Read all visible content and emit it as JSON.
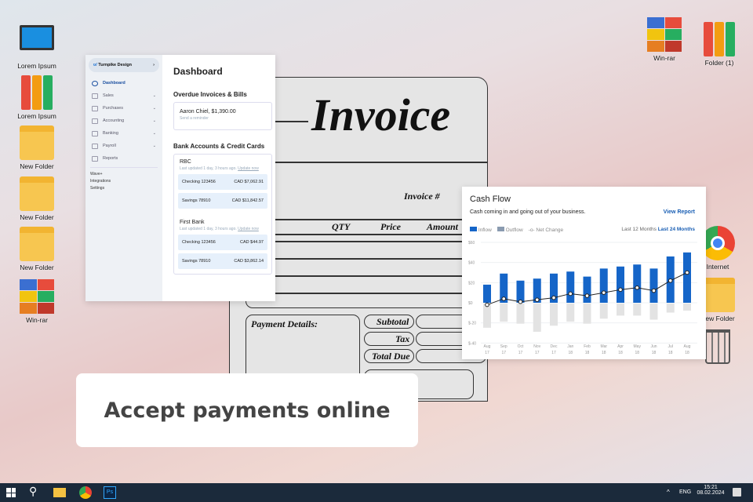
{
  "desktop": {
    "left": [
      "Lorem Ipsum",
      "Lorem Ipsum",
      "New Folder",
      "New Folder",
      "New Folder",
      "Win-rar"
    ],
    "right": [
      "Win-rar",
      "Folder (1)",
      "Internet",
      "New Folder"
    ]
  },
  "dashboard": {
    "brand": "Turnpike Design",
    "nav": [
      {
        "label": "Dashboard",
        "active": true
      },
      {
        "label": "Sales"
      },
      {
        "label": "Purchases"
      },
      {
        "label": "Accounting"
      },
      {
        "label": "Banking"
      },
      {
        "label": "Payroll"
      },
      {
        "label": "Reports"
      }
    ],
    "links": [
      "Wave+",
      "Integrations",
      "Settings"
    ],
    "title": "Dashboard",
    "overdue_title": "Overdue Invoices & Bills",
    "overdue_item": "Aaron Chiel, $1,390.00",
    "overdue_action": "Send a reminder",
    "bank_title": "Bank Accounts & Credit Cards",
    "updated": "Last updated 1 day, 3 hours ago.",
    "update_now": "Update now",
    "banks": [
      {
        "name": "RBC",
        "accounts": [
          {
            "name": "Checking 123456",
            "amount": "CAD $7,062.91"
          },
          {
            "name": "Savings 78910",
            "amount": "CAD $11,842.57"
          }
        ]
      },
      {
        "name": "First Bank",
        "accounts": [
          {
            "name": "Checking 123456",
            "amount": "CAD $44.97"
          },
          {
            "name": "Savings 78910",
            "amount": "CAD $3,862.14"
          }
        ]
      }
    ]
  },
  "invoice": {
    "title": "Invoice",
    "invoice_no": "Invoice #",
    "colon": ":",
    "cols": [
      "QTY",
      "Price",
      "Amount"
    ],
    "payment": "Payment Details:",
    "subtotal": "Subtotal",
    "tax": "Tax",
    "total": "Total Due"
  },
  "chart_data": {
    "type": "bar",
    "title": "Cash Flow",
    "subtitle": "Cash coming in and going out of your business.",
    "link": "View Report",
    "legend": [
      "Inflow",
      "Outflow",
      "Net Change"
    ],
    "ranges": [
      "Last 12 Months",
      "Last 24 Months"
    ],
    "active_range": "Last 24 Months",
    "categories": [
      [
        "Aug",
        "17"
      ],
      [
        "Sep",
        "17"
      ],
      [
        "Oct",
        "17"
      ],
      [
        "Nov",
        "17"
      ],
      [
        "Dec",
        "17"
      ],
      [
        "Jan",
        "18"
      ],
      [
        "Feb",
        "18"
      ],
      [
        "Mar",
        "18"
      ],
      [
        "Apr",
        "18"
      ],
      [
        "May",
        "18"
      ],
      [
        "Jun",
        "18"
      ],
      [
        "Jul",
        "18"
      ],
      [
        "Aug",
        "18"
      ]
    ],
    "yticks": [
      "$60",
      "$40",
      "$20",
      "$0",
      "$-20",
      "$-40"
    ],
    "ylim": [
      -40,
      60
    ],
    "series": [
      {
        "name": "Inflow",
        "color": "#1565c8",
        "values": [
          18,
          29,
          22,
          24,
          29,
          31,
          26,
          34,
          36,
          38,
          34,
          46,
          50
        ]
      },
      {
        "name": "Outflow",
        "color": "#e3e3e3",
        "values": [
          -24,
          -18,
          -20,
          -28,
          -22,
          -18,
          -20,
          -15,
          -12,
          -12,
          -16,
          -9,
          -7
        ]
      },
      {
        "name": "Net Change",
        "color": "#222",
        "values": [
          -2,
          4,
          1,
          3,
          5,
          9,
          7,
          10,
          13,
          15,
          12,
          22,
          30
        ]
      }
    ]
  },
  "banner": "Accept payments online",
  "taskbar": {
    "lang": "ENG",
    "time": "15:21",
    "date": "08.02.2024"
  }
}
